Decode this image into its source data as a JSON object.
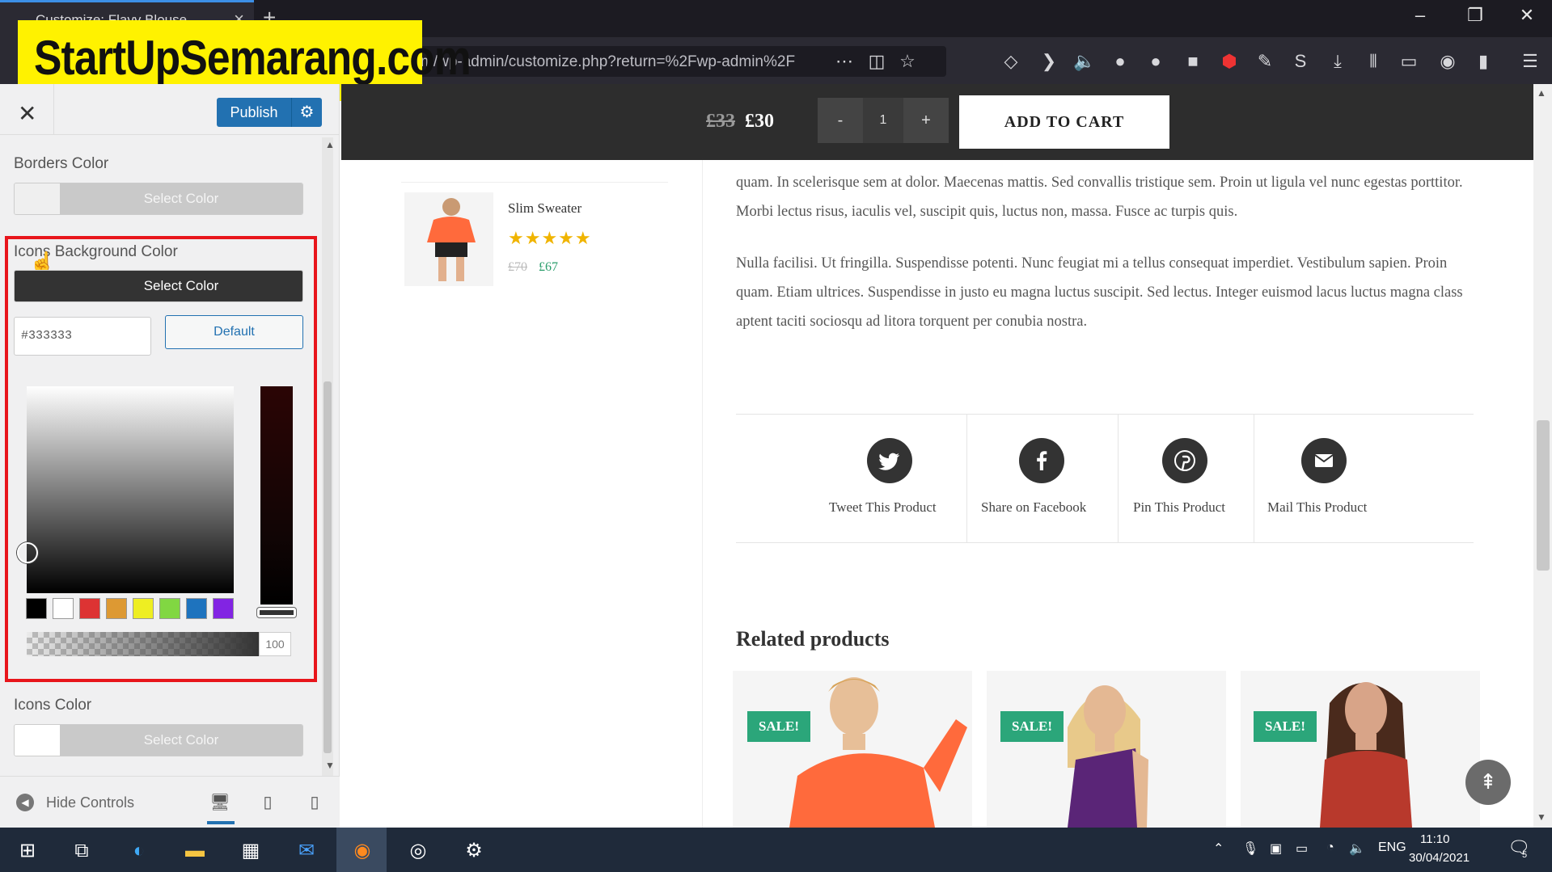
{
  "browser": {
    "tab_title": "Customize: Flavy Blouse",
    "url": "m/wp-admin/customize.php?return=%2Fwp-admin%2F"
  },
  "watermark": "StartUpSemarang.com",
  "customizer": {
    "publish_label": "Publish",
    "sections": {
      "borders": {
        "label": "Borders Color",
        "button": "Select Color"
      },
      "icons_bg": {
        "label": "Icons Background Color",
        "button": "Select Color",
        "hex_value": "#333333",
        "default_label": "Default",
        "alpha_value": "100",
        "palette": [
          "#000000",
          "#ffffff",
          "#dd3333",
          "#dd9933",
          "#eeee22",
          "#81d742",
          "#1e73be",
          "#8224e3"
        ]
      },
      "icons_color": {
        "label": "Icons Color",
        "button": "Select Color"
      }
    },
    "footer": {
      "hide_controls": "Hide Controls"
    }
  },
  "preview": {
    "sticky": {
      "price_old": "£33",
      "price_new": "£30",
      "qty": "1",
      "minus": "-",
      "plus": "+",
      "add_to_cart": "ADD TO CART"
    },
    "widget_product": {
      "name": "Slim Sweater",
      "price_old": "£70",
      "price_new": "£67",
      "rating": 5
    },
    "paragraphs": [
      "quam. In scelerisque sem at dolor. Maecenas mattis. Sed convallis tristique sem. Proin ut ligula vel nunc egestas porttitor. Morbi lectus risus, iaculis vel, suscipit quis, luctus non, massa. Fusce ac turpis quis.",
      "Nulla facilisi. Ut fringilla. Suspendisse potenti. Nunc feugiat mi a tellus consequat imperdiet. Vestibulum sapien. Proin quam. Etiam ultrices. Suspendisse in justo eu magna luctus suscipit. Sed lectus. Integer euismod lacus luctus magna class aptent taciti sociosqu ad litora torquent per conubia nostra."
    ],
    "share": [
      {
        "label": "Tweet This Product",
        "icon": "twitter-icon"
      },
      {
        "label": "Share on Facebook",
        "icon": "facebook-icon"
      },
      {
        "label": "Pin This Product",
        "icon": "pinterest-icon"
      },
      {
        "label": "Mail This Product",
        "icon": "mail-icon"
      }
    ],
    "related_title": "Related products",
    "sale_badge": "SALE!"
  },
  "taskbar": {
    "lang": "ENG",
    "time": "11:10",
    "date": "30/04/2021",
    "notifications": "5"
  },
  "colors": {
    "icon_bg": "#333333",
    "accent_blue": "#2271b1",
    "sale_green": "#2ba67a",
    "highlight_red": "#e8151b"
  }
}
